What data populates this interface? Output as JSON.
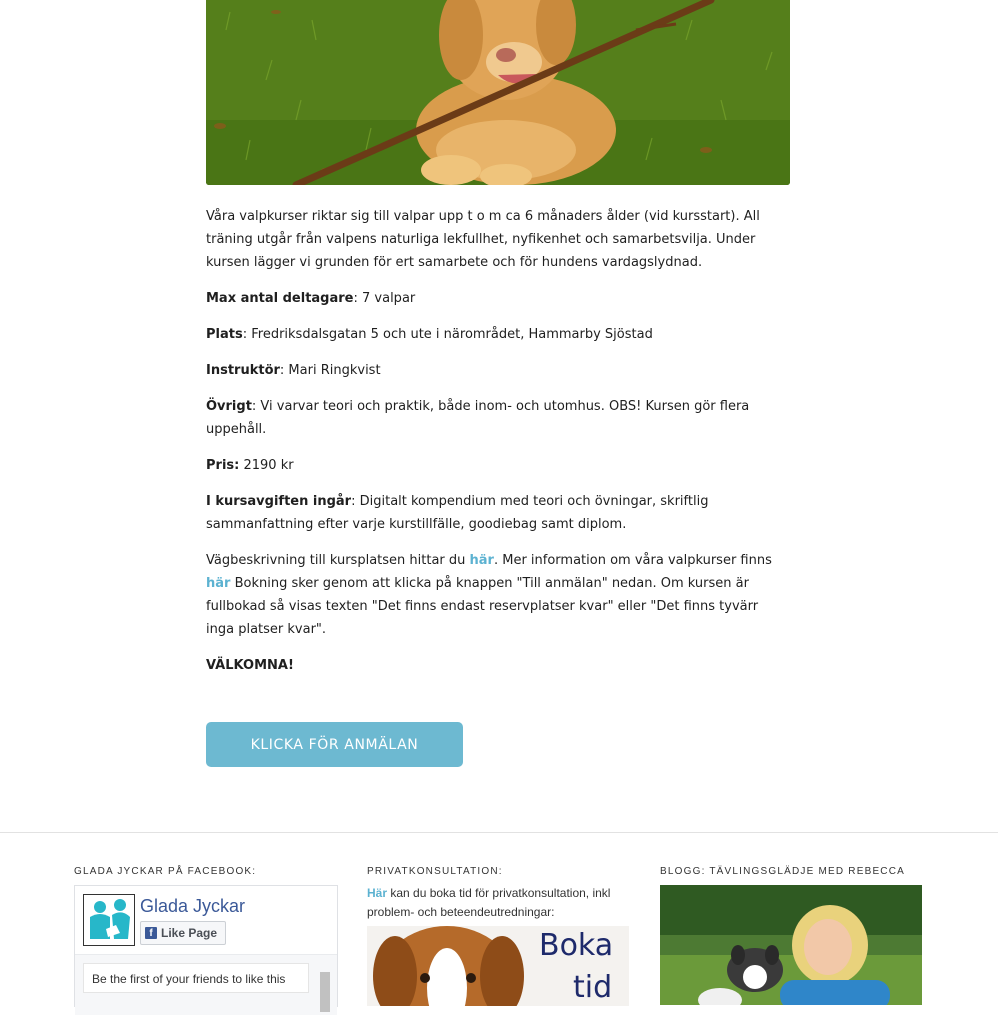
{
  "hero": {
    "image_alt": "Valp som tuggar på en pinne i gräset"
  },
  "content": {
    "intro": "Våra valpkurser riktar sig till valpar upp t o m ca 6 månaders ålder (vid kursstart). All träning utgår från valpens naturliga lekfullhet, nyfikenhet och samarbetsvilja. Under kursen lägger vi grunden för ert samarbete och för hundens vardagslydnad.",
    "max": {
      "label": "Max antal deltagare",
      "value": ": 7 valpar"
    },
    "plats": {
      "label": "Plats",
      "value": ": Fredriksdalsgatan 5 och ute i närområdet, Hammarby Sjöstad"
    },
    "instruktor": {
      "label": "Instruktör",
      "value": ": Mari Ringkvist"
    },
    "ovrigt": {
      "label": "Övrigt",
      "value": ": Vi varvar teori och praktik, både inom- och utomhus. OBS! Kursen gör flera uppehåll."
    },
    "pris": {
      "label": "Pris:",
      "value": " 2190 kr"
    },
    "kursavgift": {
      "label": "I kursavgiften ingår",
      "value": ": Digitalt kompendium med teori och övningar, skriftlig sammanfattning efter varje kurstillfälle, goodiebag samt diplom."
    },
    "directions": {
      "part1": "Vägbeskrivning till kursplatsen hittar du ",
      "link1": "här",
      "part2": ". Mer information om våra valpkurser finns ",
      "link2": "här",
      "part3": " Bokning sker genom att klicka på knappen \"Till anmälan\" nedan. Om kursen är fullbokad så visas texten \"Det finns endast reservplatser kvar\" eller \"Det finns tyvärr inga platser kvar\"."
    },
    "welcome": "VÄLKOMNA!"
  },
  "cta": {
    "label": "KLICKA FÖR ANMÄLAN"
  },
  "footer": {
    "facebook": {
      "heading": "GLADA JYCKAR PÅ FACEBOOK:",
      "page_name": "Glada Jyckar",
      "like_label": "Like Page",
      "friends_text": "Be the first of your friends to like this"
    },
    "privat": {
      "heading": "PRIVATKONSULTATION:",
      "link": "Här",
      "text": " kan du boka tid för privatkonsultation, inkl problem- och beteendeutredningar:",
      "image_word1": "Boka",
      "image_word2": "tid"
    },
    "blogg": {
      "heading": "BLOGG: TÄVLINGSGLÄDJE MED REBECCA"
    }
  },
  "colors": {
    "accent": "#6db9d1",
    "link": "#5cb2d1",
    "facebook": "#3b5998"
  }
}
